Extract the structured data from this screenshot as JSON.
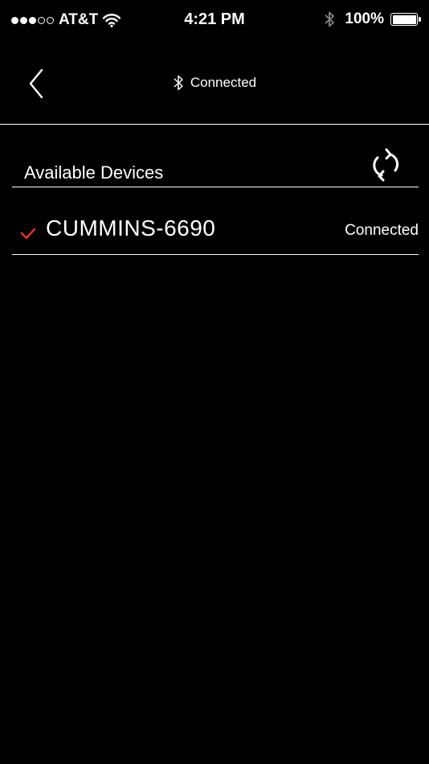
{
  "status_bar": {
    "signal_dots": [
      true,
      true,
      true,
      false,
      false
    ],
    "carrier": "AT&T",
    "time": "4:21 PM",
    "battery_percent": "100%"
  },
  "nav": {
    "title": "Connected",
    "title_icon": "bluetooth-icon",
    "back_icon": "chevron-left-icon"
  },
  "section": {
    "title": "Available Devices",
    "refresh_icon": "refresh-icon"
  },
  "devices": [
    {
      "name": "CUMMINS-6690",
      "status": "Connected",
      "selected": true
    }
  ],
  "colors": {
    "background": "#000000",
    "text": "#ffffff",
    "check": "#e0302c"
  }
}
